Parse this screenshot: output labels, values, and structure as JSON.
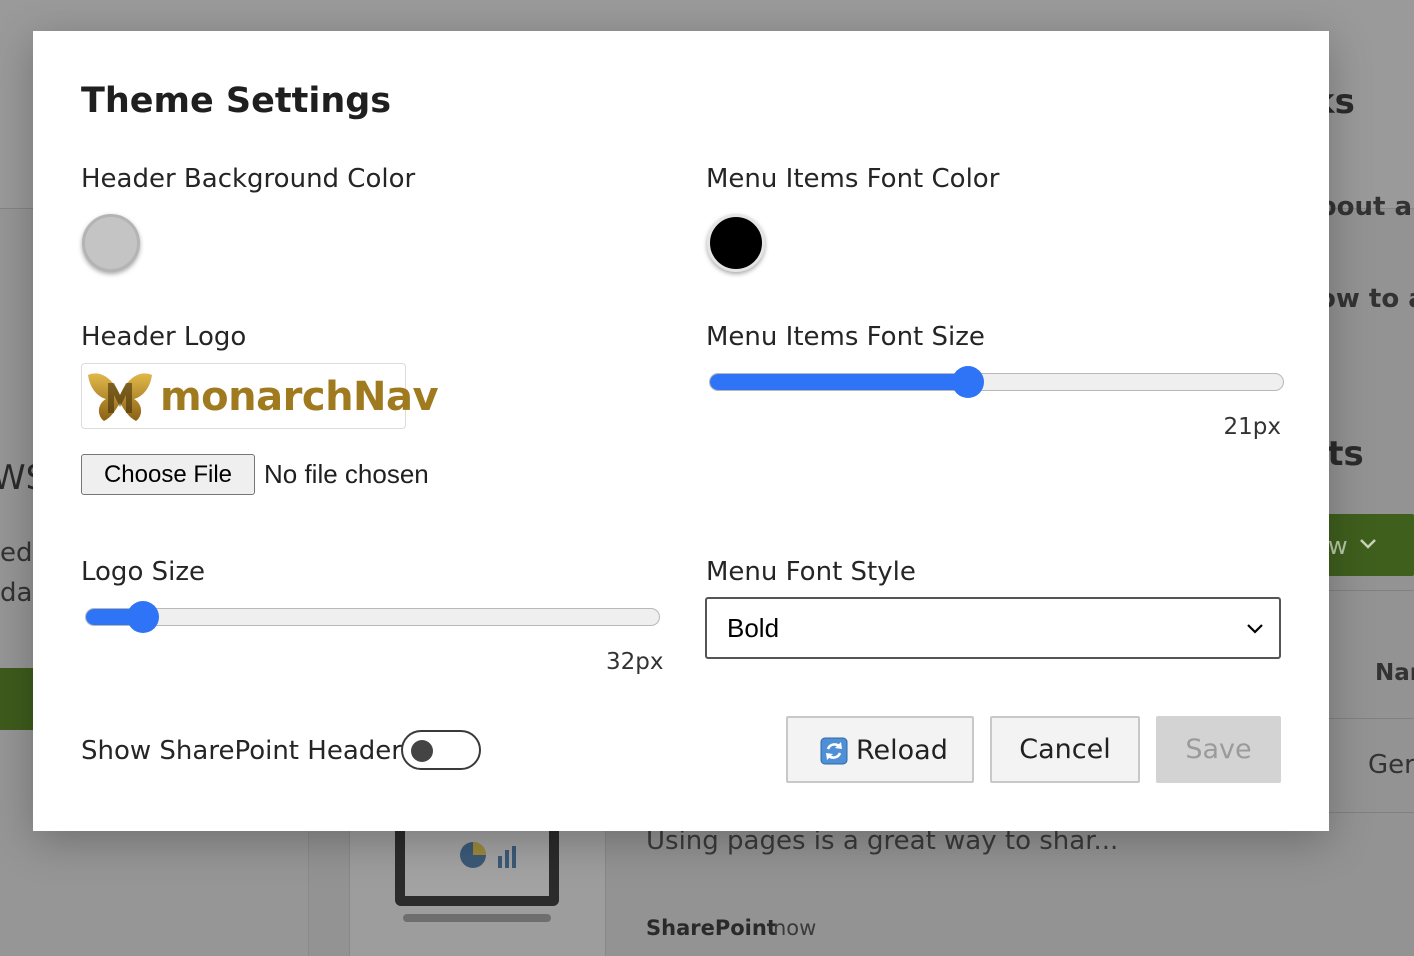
{
  "background": {
    "heading_right_top": "ks",
    "line_about": "bout a",
    "line_how": "ow to a",
    "heading_right_mid": "nts",
    "heading_left": "WS",
    "left_line1": "ed",
    "left_line2": "da",
    "green_btn_text": "w",
    "col_header": "Nar",
    "row_cell": "Ger",
    "news_snippet": "Using pages is a great way to shar...",
    "news_source": "SharePoint",
    "news_time": "now"
  },
  "modal": {
    "title": "Theme Settings",
    "header_bg_color": {
      "label": "Header Background Color",
      "value": "#c4c4c4"
    },
    "menu_font_color": {
      "label": "Menu Items Font Color",
      "value": "#000000"
    },
    "header_logo": {
      "label": "Header Logo",
      "logo_text": "monarchNav",
      "choose_file_label": "Choose File",
      "file_status": "No file chosen"
    },
    "menu_font_size": {
      "label": "Menu Items Font Size",
      "value_text": "21px",
      "fraction": 0.45
    },
    "logo_size": {
      "label": "Logo Size",
      "value_text": "32px",
      "fraction": 0.1
    },
    "menu_font_style": {
      "label": "Menu Font Style",
      "selected": "Bold"
    },
    "show_sharepoint_header": {
      "label": "Show SharePoint Header",
      "on": false
    },
    "buttons": {
      "reload": "Reload",
      "cancel": "Cancel",
      "save": "Save"
    }
  },
  "icons": {
    "reload": "refresh-icon",
    "select": "chevron-down-icon",
    "logo": "butterfly-logo-icon"
  },
  "colors": {
    "accent": "#2f74f6",
    "green": "#3f5f1d"
  }
}
